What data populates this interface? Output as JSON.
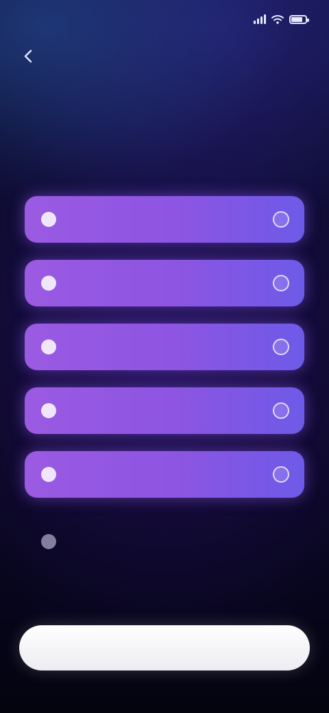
{
  "status_bar": {
    "time": "",
    "icons": [
      "signal-icon",
      "wifi-icon",
      "battery-icon"
    ]
  },
  "header": {
    "back_icon": "chevron-left-icon"
  },
  "question": {
    "line1": "",
    "line2": ""
  },
  "options": [
    {
      "label": "",
      "icon": "option-icon"
    },
    {
      "label": "",
      "icon": "option-icon"
    },
    {
      "label": "",
      "icon": "option-icon"
    },
    {
      "label": "",
      "icon": "option-icon"
    },
    {
      "label": "",
      "icon": "option-icon"
    }
  ],
  "other": {
    "label": "",
    "icon": "plus-icon"
  },
  "continue_button": {
    "label": ""
  },
  "colors": {
    "background": "#0b0a2a",
    "option_gradient_start": "#9b5ae2",
    "option_gradient_end": "#6e5ae8",
    "button_background": "#ffffff",
    "button_text": "#8f8fa0"
  }
}
